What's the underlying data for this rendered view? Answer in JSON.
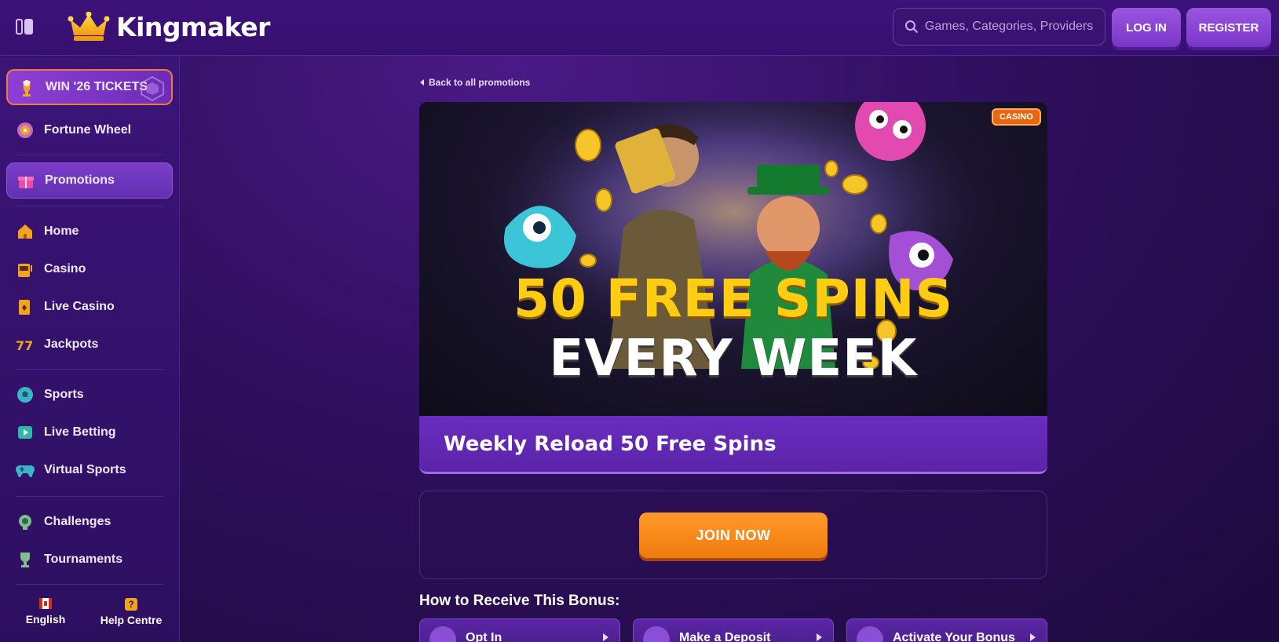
{
  "header": {
    "brand": "Kingmaker",
    "search_placeholder": "Games, Categories, Providers",
    "login_label": "LOG IN",
    "register_label": "REGISTER"
  },
  "sidebar": {
    "items": [
      {
        "label": "WIN '26 TICKETS",
        "icon": "trophy-ball-icon"
      },
      {
        "label": "Fortune Wheel",
        "icon": "fortune-wheel-icon"
      },
      {
        "label": "Promotions",
        "icon": "gift-icon"
      },
      {
        "label": "Home",
        "icon": "home-icon"
      },
      {
        "label": "Casino",
        "icon": "slot-machine-icon"
      },
      {
        "label": "Live Casino",
        "icon": "playing-card-icon"
      },
      {
        "label": "Jackpots",
        "icon": "777-icon"
      },
      {
        "label": "Sports",
        "icon": "soccer-ball-icon"
      },
      {
        "label": "Live Betting",
        "icon": "live-play-icon"
      },
      {
        "label": "Virtual Sports",
        "icon": "gamepad-icon"
      },
      {
        "label": "Challenges",
        "icon": "medal-icon"
      },
      {
        "label": "Tournaments",
        "icon": "trophy-icon"
      }
    ],
    "footer": {
      "language": "English",
      "help": "Help Centre"
    }
  },
  "promotion": {
    "back_link": "Back to all promotions",
    "badge": "CASINO",
    "banner_line1": "50 FREE SPINS",
    "banner_line2": "EVERY WEEK",
    "title": "Weekly Reload 50 Free Spins",
    "join_label": "JOIN NOW",
    "how_title": "How to Receive This Bonus:",
    "steps": [
      {
        "label": "Opt In"
      },
      {
        "label": "Make a Deposit"
      },
      {
        "label": "Activate Your Bonus"
      }
    ]
  },
  "colors": {
    "accent_orange": "#f07a0c",
    "accent_purple": "#7a36c8",
    "banner_yellow": "#ffcc14"
  }
}
